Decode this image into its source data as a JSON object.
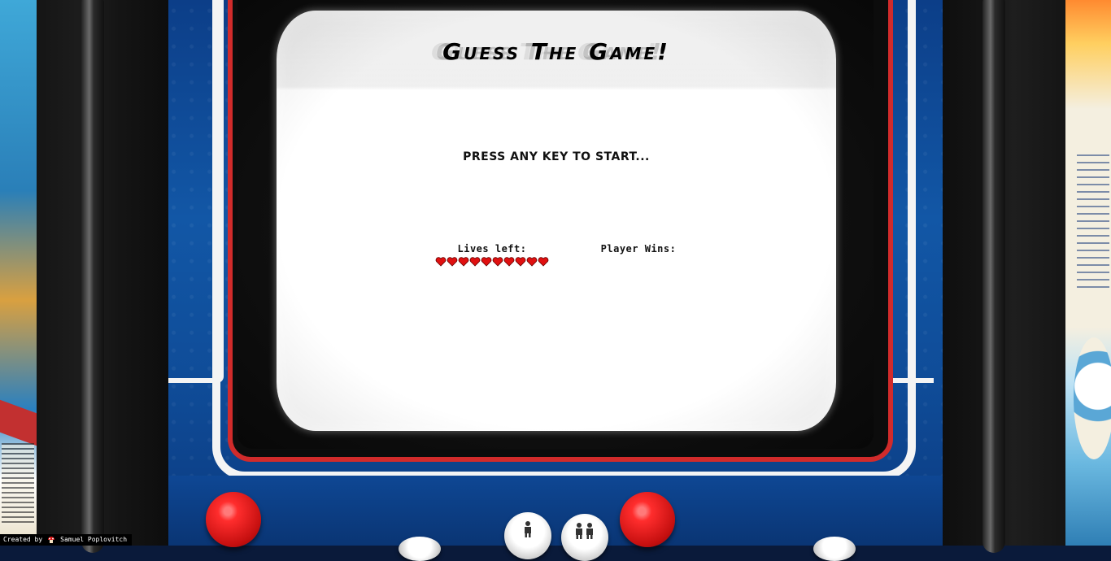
{
  "screen": {
    "title": "Guess The Game!",
    "prompt": "PRESS ANY KEY TO START...",
    "lives_label": "Lives left:",
    "lives_count": 10,
    "wins_label": "Player Wins:"
  },
  "controls": {
    "player1_icon": "one-player-icon",
    "player2_icon": "two-player-icon"
  },
  "credit": {
    "prefix": "Created by",
    "author": "Samuel Poplovitch",
    "logo_icon": "mushroom-icon"
  },
  "colors": {
    "heart": "#e01010",
    "accent_red": "#d12b2b",
    "cabinet_blue": "#1257a6"
  }
}
